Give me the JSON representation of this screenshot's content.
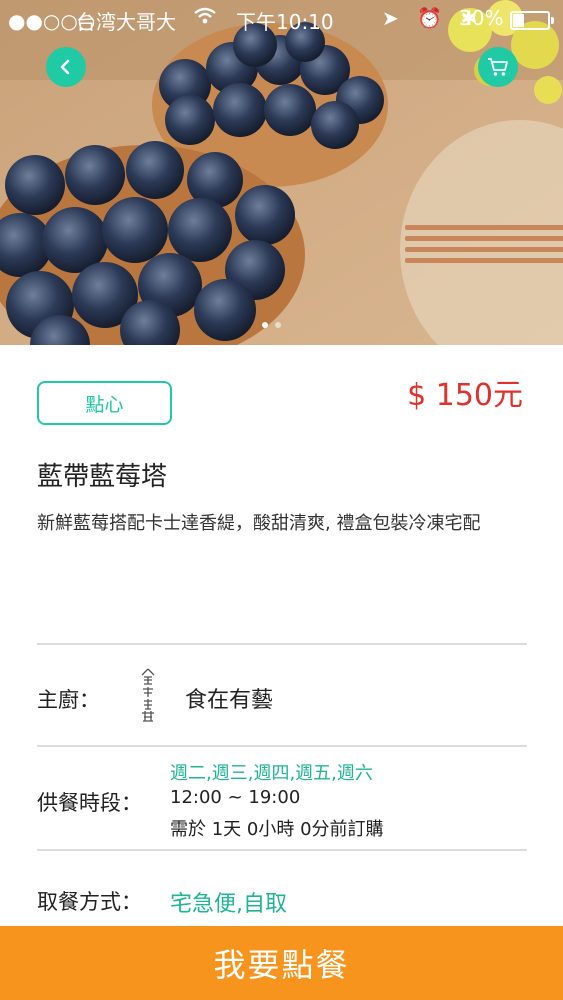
{
  "status_bar": {
    "signal": "●●○○○",
    "carrier": "台湾大哥大",
    "time": "下午10:10",
    "battery": "30%"
  },
  "hero": {
    "back_icon": "chevron-left-icon",
    "cart_icon": "cart-icon",
    "accent": "#1fcaa4",
    "carousel_dot_count": 2
  },
  "product": {
    "category": "點心",
    "price": "$ 150元",
    "name": "藍帶藍莓塔",
    "description": "新鮮藍莓搭配卡士達香緹，酸甜清爽, 禮盒包裝冷凍宅配"
  },
  "details": {
    "chef_label": "主廚：",
    "chef_name": "食在有藝",
    "schedule_label": "供餐時段：",
    "days": "週二,週三,週四,週五,週六",
    "hours": "12:00 ~ 19:00",
    "order_ahead": "需於 1天 0小時 0分前訂購",
    "pickup_label": "取餐方式：",
    "pickup_methods": "宅急便,自取"
  },
  "order_button": {
    "label": "我要點餐",
    "color": "#f7941d"
  },
  "colors": {
    "price": "#e0312b",
    "accent_text": "#1fb597"
  }
}
